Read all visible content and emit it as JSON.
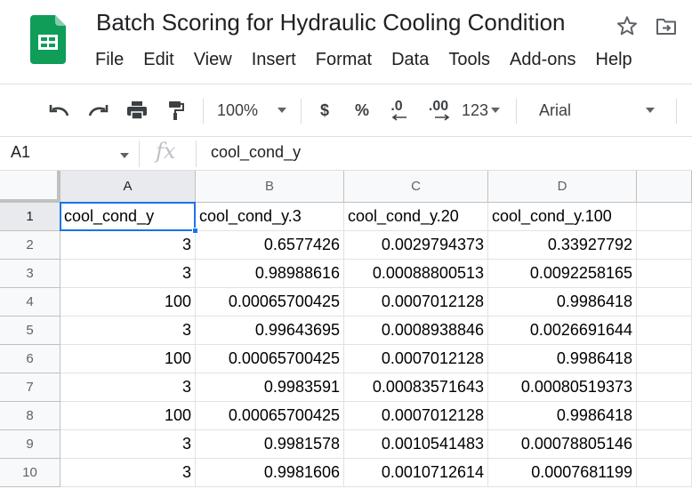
{
  "title": "Batch Scoring for Hydraulic Cooling Condition",
  "menu": [
    "File",
    "Edit",
    "View",
    "Insert",
    "Format",
    "Data",
    "Tools",
    "Add-ons",
    "Help"
  ],
  "toolbar": {
    "zoom": "100%",
    "currency": "$",
    "percent": "%",
    "dec_decrease": ".0",
    "dec_increase": ".00",
    "more_formats": "123",
    "font": "Arial"
  },
  "formula_bar": {
    "cell_ref": "A1",
    "fx": "fx",
    "content": "cool_cond_y"
  },
  "colors": {
    "accent": "#1a73e8",
    "logo_green": "#0f9d58"
  },
  "icons": [
    "sheets-logo-icon",
    "star-icon",
    "move-to-folder-icon",
    "undo-icon",
    "redo-icon",
    "print-icon",
    "paint-format-icon"
  ],
  "grid": {
    "columns": [
      "A",
      "B",
      "C",
      "D"
    ],
    "rows": [
      {
        "n": "1",
        "cells": [
          "cool_cond_y",
          "cool_cond_y.3",
          "cool_cond_y.20",
          "cool_cond_y.100"
        ]
      },
      {
        "n": "2",
        "cells": [
          "3",
          "0.6577426",
          "0.0029794373",
          "0.33927792"
        ]
      },
      {
        "n": "3",
        "cells": [
          "3",
          "0.98988616",
          "0.00088800513",
          "0.0092258165"
        ]
      },
      {
        "n": "4",
        "cells": [
          "100",
          "0.00065700425",
          "0.0007012128",
          "0.9986418"
        ]
      },
      {
        "n": "5",
        "cells": [
          "3",
          "0.99643695",
          "0.0008938846",
          "0.0026691644"
        ]
      },
      {
        "n": "6",
        "cells": [
          "100",
          "0.00065700425",
          "0.0007012128",
          "0.9986418"
        ]
      },
      {
        "n": "7",
        "cells": [
          "3",
          "0.9983591",
          "0.00083571643",
          "0.00080519373"
        ]
      },
      {
        "n": "8",
        "cells": [
          "100",
          "0.00065700425",
          "0.0007012128",
          "0.9986418"
        ]
      },
      {
        "n": "9",
        "cells": [
          "3",
          "0.9981578",
          "0.0010541483",
          "0.00078805146"
        ]
      },
      {
        "n": "10",
        "cells": [
          "3",
          "0.9981606",
          "0.0010712614",
          "0.0007681199"
        ]
      }
    ]
  }
}
